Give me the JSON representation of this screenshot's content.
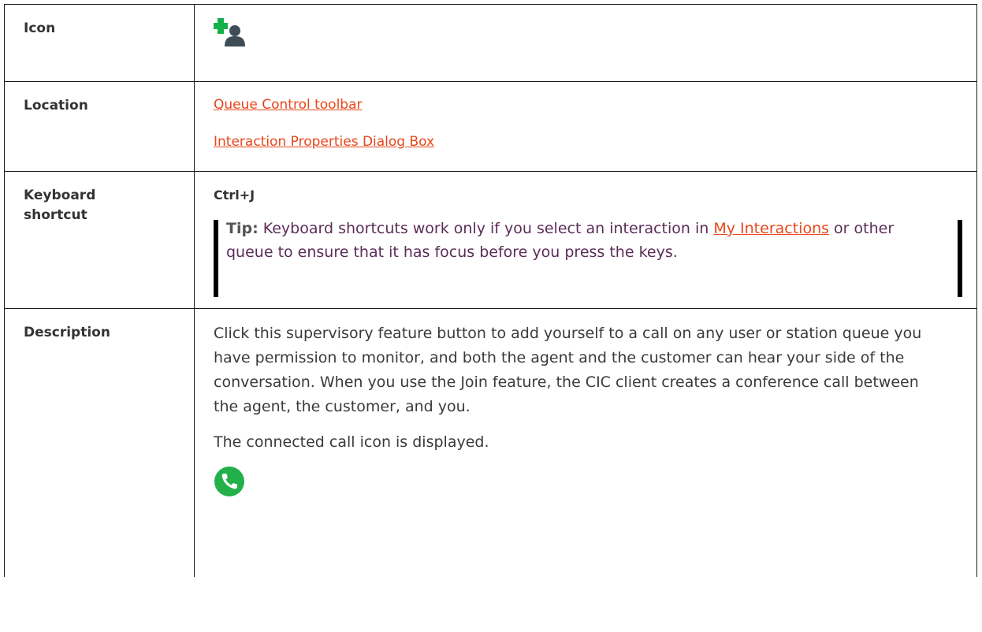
{
  "rows": {
    "icon": {
      "label": "Icon",
      "icon_name": "join-user-plus-icon",
      "colors": {
        "plus": "#14b14a",
        "person": "#3e4c55"
      }
    },
    "location": {
      "label": "Location",
      "links": [
        "Queue Control toolbar",
        "Interaction Properties Dialog Box"
      ],
      "link_color": "#e8461a"
    },
    "keyboard": {
      "label": "Keyboard shortcut",
      "shortcut": "Ctrl+J",
      "tip": {
        "label": "Tip:",
        "text_before": " Keyboard shortcuts work only if you select an interaction in ",
        "link": "My Interactions",
        "text_after": " or other queue to ensure that it has focus before you press the keys."
      }
    },
    "description": {
      "label": "Description",
      "paragraph1": "Click this supervisory feature button to add yourself to a call on any user or station queue you have permission to monitor, and both the agent and the customer can hear your side of the conversation. When you use the Join feature, the CIC client creates a conference call between the agent, the customer, and you.",
      "paragraph2": "The connected call icon is displayed.",
      "icon_name": "connected-call-icon",
      "icon_color": "#22b04b"
    }
  }
}
